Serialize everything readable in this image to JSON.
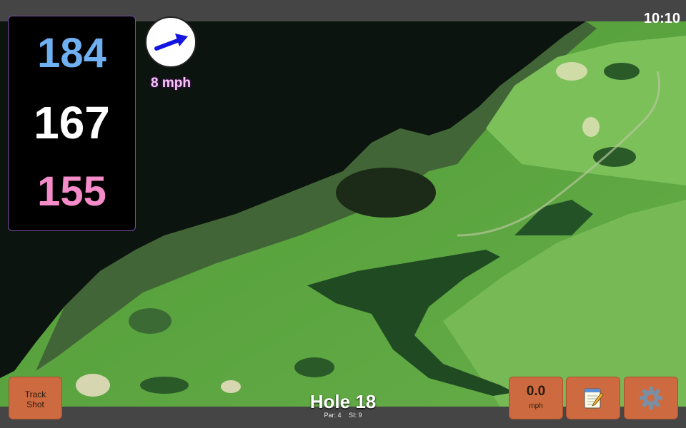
{
  "status": {
    "time": "10:10"
  },
  "distances": {
    "back": "184",
    "middle": "167",
    "front": "155"
  },
  "wind": {
    "speed_label": "8 mph",
    "icon": "wind-direction-arrow-icon"
  },
  "hole": {
    "title": "Hole 18",
    "par_label": "Par: 4",
    "si_label": "SI: 9"
  },
  "buttons": {
    "track_shot": {
      "line1": "Track",
      "line2": "Shot"
    },
    "speed": {
      "value": "0.0",
      "unit": "mph"
    },
    "notes": {
      "icon": "notepad-icon"
    },
    "settings": {
      "icon": "gear-icon"
    }
  },
  "colors": {
    "back_distance": "#6fb0f2",
    "middle_distance": "#ffffff",
    "front_distance": "#f58bc8",
    "button": "#cd6a3f"
  }
}
